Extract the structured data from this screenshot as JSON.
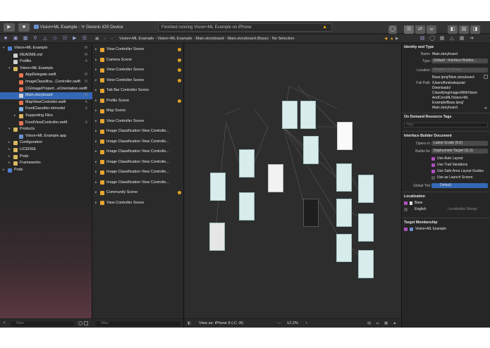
{
  "toolbar": {
    "scheme_target": "Vision+ML Example",
    "scheme_device": "Generic iOS Device",
    "status_text": "Finished running Vision+ML Example on iPhone"
  },
  "navigator": {
    "filter_placeholder": "Filter",
    "rows": [
      {
        "label": "Vision+ML Example",
        "status": "M",
        "depth": 0,
        "kind": "project",
        "open": true
      },
      {
        "label": "README.md",
        "status": "M",
        "depth": 1,
        "kind": "file"
      },
      {
        "label": "Podfile",
        "status": "A",
        "depth": 1,
        "kind": "file"
      },
      {
        "label": "Vision+ML Example",
        "status": "",
        "depth": 1,
        "kind": "folder",
        "open": true
      },
      {
        "label": "AppDelegate.swift",
        "status": "M",
        "depth": 2,
        "kind": "swift"
      },
      {
        "label": "ImageClassifica...Controller.swift",
        "status": "M",
        "depth": 2,
        "kind": "swift"
      },
      {
        "label": "CGImagePropert...eOrientation.swift",
        "status": "M",
        "depth": 2,
        "kind": "swift"
      },
      {
        "label": "Main.storyboard",
        "status": "M",
        "depth": 2,
        "kind": "storyboard",
        "selected": true
      },
      {
        "label": "MapViewController.swift",
        "status": "A",
        "depth": 2,
        "kind": "swift"
      },
      {
        "label": "FoodClassifier.mlmodel",
        "status": "A",
        "depth": 2,
        "kind": "model"
      },
      {
        "label": "Supporting Files",
        "status": "",
        "depth": 2,
        "kind": "folder",
        "open": false
      },
      {
        "label": "FoodViewController.swift",
        "status": "A",
        "depth": 2,
        "kind": "swift"
      },
      {
        "label": "Products",
        "status": "",
        "depth": 1,
        "kind": "folder",
        "open": true
      },
      {
        "label": "Vision+ML Example.app",
        "status": "",
        "depth": 2,
        "kind": "app"
      },
      {
        "label": "Configuration",
        "status": "",
        "depth": 1,
        "kind": "folder",
        "open": false
      },
      {
        "label": "LICENSE",
        "status": "",
        "depth": 1,
        "kind": "folder",
        "open": false
      },
      {
        "label": "Pods",
        "status": "",
        "depth": 1,
        "kind": "folder",
        "open": false
      },
      {
        "label": "Frameworks",
        "status": "",
        "depth": 1,
        "kind": "folder",
        "open": false
      },
      {
        "label": "Pods",
        "status": "",
        "depth": 0,
        "kind": "project",
        "open": false
      }
    ]
  },
  "jumpbar": {
    "crumbs": [
      "Vision+ML Example",
      "Vision+ML Example",
      "Main.storyboard",
      "Main.storyboard (Base)",
      "No Selection"
    ]
  },
  "outline": {
    "filter_placeholder": "Filter",
    "scenes": [
      {
        "label": "View Controller Scene",
        "warn": true
      },
      {
        "label": "Camera Scene",
        "warn": true
      },
      {
        "label": "View Controller Scene",
        "warn": true
      },
      {
        "label": "View Controller Scene",
        "warn": true
      },
      {
        "label": "Tab Bar Controller Scene",
        "warn": false
      },
      {
        "label": "Profile Scene",
        "warn": true
      },
      {
        "label": "Map Scene",
        "warn": false
      },
      {
        "label": "View Controller Scene",
        "warn": false
      },
      {
        "label": "Image Classification View Controlle...",
        "warn": false
      },
      {
        "label": "Image Classification View Controlle...",
        "warn": false
      },
      {
        "label": "Image Classification View Controlle...",
        "warn": false
      },
      {
        "label": "Image Classification View Controlle...",
        "warn": false
      },
      {
        "label": "Image Classification View Controlle...",
        "warn": false
      },
      {
        "label": "Image Classification View Controlle...",
        "warn": false
      },
      {
        "label": "Community Scene",
        "warn": true
      },
      {
        "label": "View Controller Scene",
        "warn": false
      }
    ]
  },
  "canvas_bar": {
    "view_as": "View as: iPhone 8 (‐C ‐R)",
    "zoom": "12.2%",
    "minus": "—",
    "plus": "+"
  },
  "inspector": {
    "identity_title": "Identity and Type",
    "name_label": "Name",
    "name_value": "Main.storyboard",
    "type_label": "Type",
    "type_value": "Default - Interface Builder...",
    "location_label": "Location",
    "location_value": "Relative to Group",
    "location_file": "Base.lproj/Main.storyboard",
    "fullpath_label": "Full Path",
    "fullpath_lines": [
      "/Users/thrishakopula/",
      "Downloads/",
      "ClassifyingImagesWithVision",
      "AndCoreML/Vision+ML",
      "Example/Base.lproj/",
      "Main.storyboard"
    ],
    "odr_title": "On Demand Resource Tags",
    "tags_placeholder": "Tags",
    "ibd_title": "Interface Builder Document",
    "opens_in_label": "Opens in",
    "opens_in_value": "Latest Xcode (9.0)",
    "builds_for_label": "Builds for",
    "builds_for_value": "Deployment Target (11.0)",
    "checks": [
      "Use Auto Layout",
      "Use Trait Variations",
      "Use Safe Area Layout Guides",
      "Use as Launch Screen"
    ],
    "global_tint_label": "Global Tint",
    "global_tint_value": "Default",
    "localization_title": "Localization",
    "loc_base": "Base",
    "loc_english": "English",
    "loc_english_value": "Localizable Strings",
    "target_title": "Target Membership",
    "target_name": "Vision+ML Example"
  },
  "colors": {
    "selection": "#3468b6",
    "warning": "#e0a020",
    "accent_check": "#b04fc4"
  }
}
